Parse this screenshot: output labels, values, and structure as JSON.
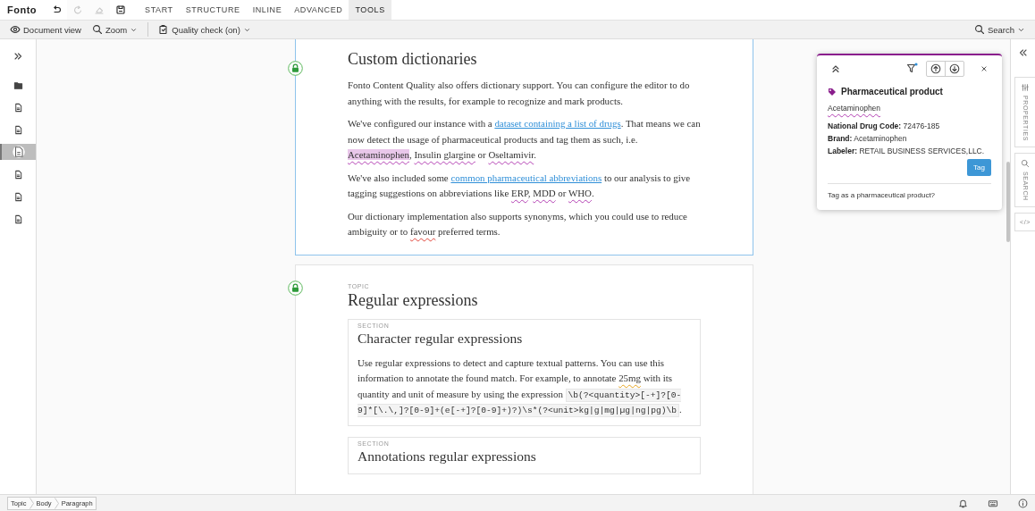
{
  "app": {
    "logo": "Fonto"
  },
  "quick_actions": [
    {
      "kind": "undo",
      "disabled": false
    },
    {
      "kind": "redo",
      "disabled": true
    },
    {
      "kind": "clear",
      "disabled": true
    },
    {
      "kind": "save",
      "disabled": false
    }
  ],
  "tabs": [
    {
      "label": "START",
      "selected": false
    },
    {
      "label": "STRUCTURE",
      "selected": false
    },
    {
      "label": "INLINE",
      "selected": false
    },
    {
      "label": "ADVANCED",
      "selected": false
    },
    {
      "label": "TOOLS",
      "selected": true
    }
  ],
  "toolbar": {
    "items": [
      {
        "kind": "view",
        "label": "Document view",
        "dropdown": false
      },
      {
        "kind": "zoom",
        "label": "Zoom",
        "dropdown": true
      },
      {
        "kind": "quality",
        "label": "Quality check (on)",
        "dropdown": true
      }
    ],
    "search": "Search"
  },
  "sidebar": {
    "items": [
      {
        "kind": "folder",
        "selected": false
      },
      {
        "kind": "document",
        "selected": false
      },
      {
        "kind": "document",
        "selected": false
      },
      {
        "kind": "document",
        "selected": true
      },
      {
        "kind": "document",
        "selected": false
      },
      {
        "kind": "document",
        "selected": false
      },
      {
        "kind": "document",
        "selected": false
      }
    ]
  },
  "document": {
    "topics": [
      {
        "selected": true,
        "title": "Custom dictionaries",
        "paragraphs": [
          [
            {
              "kind": "text",
              "t": "Fonto Content Quality also offers dictionary support. You can configure the editor to do anything with the results, for example to recognize and mark products."
            }
          ],
          [
            {
              "kind": "text",
              "t": "We've configured our instance with a "
            },
            {
              "kind": "link",
              "t": "dataset containing a list of drugs"
            },
            {
              "kind": "text",
              "t": ". That means we can now detect the usage of pharmaceutical products and tag them as such, i.e. "
            },
            {
              "kind": "term-active",
              "t": "Acetaminophen"
            },
            {
              "kind": "text",
              "t": ", "
            },
            {
              "kind": "term",
              "t": "Insulin glargine"
            },
            {
              "kind": "text",
              "t": " or "
            },
            {
              "kind": "term",
              "t": "Oseltamivir"
            },
            {
              "kind": "text",
              "t": "."
            }
          ],
          [
            {
              "kind": "text",
              "t": "We've also included some "
            },
            {
              "kind": "link",
              "t": "common pharmaceutical abbreviations"
            },
            {
              "kind": "text",
              "t": " to our analysis to give tagging suggestions on abbreviations like "
            },
            {
              "kind": "term",
              "t": "ERP"
            },
            {
              "kind": "text",
              "t": ", "
            },
            {
              "kind": "term",
              "t": "MDD"
            },
            {
              "kind": "text",
              "t": " or "
            },
            {
              "kind": "term",
              "t": "WHO"
            },
            {
              "kind": "text",
              "t": "."
            }
          ],
          [
            {
              "kind": "text",
              "t": "Our dictionary implementation also supports synonyms, which you could use to reduce ambiguity or to "
            },
            {
              "kind": "misspelled",
              "t": "favour"
            },
            {
              "kind": "text",
              "t": " preferred terms."
            }
          ]
        ]
      },
      {
        "selected": false,
        "label": "TOPIC",
        "title": "Regular expressions",
        "sections": [
          {
            "label": "SECTION",
            "title": "Character regular expressions",
            "paragraphs": [
              [
                {
                  "kind": "text",
                  "t": "Use regular expressions to detect and capture textual patterns. You can use this information to annotate the found match. For example, to annotate "
                },
                {
                  "kind": "unit",
                  "t": "25mg"
                },
                {
                  "kind": "text",
                  "t": " with its quantity and unit of measure by using the expression "
                },
                {
                  "kind": "code",
                  "t": "\\b(?<quantity>[-+]?[0-9]*[\\.\\,]?[0-9]+(e[-+]?[0-9]+)?)\\s*(?<unit>kg|g|mg|µg|ng|pg)\\b"
                },
                {
                  "kind": "text",
                  "t": "."
                }
              ]
            ]
          },
          {
            "label": "SECTION",
            "title": "Annotations regular expressions"
          }
        ]
      }
    ]
  },
  "popup": {
    "title": "Pharmaceutical product",
    "term": "Acetaminophen",
    "fields": [
      {
        "label": "National Drug Code:",
        "value": "72476-185"
      },
      {
        "label": "Brand:",
        "value": "Acetaminophen"
      },
      {
        "label": "Labeler:",
        "value": "RETAIL BUSINESS SERVICES,LLC."
      }
    ],
    "button": "Tag",
    "question": "Tag as a pharmaceutical product?"
  },
  "right_panel": {
    "tabs": [
      {
        "kind": "properties",
        "label": "PROPERTIES"
      },
      {
        "kind": "search",
        "label": "SEARCH"
      },
      {
        "kind": "code",
        "label": "</>"
      }
    ]
  },
  "status_bar": {
    "breadcrumbs": [
      "Topic",
      "Body",
      "Paragraph"
    ]
  }
}
